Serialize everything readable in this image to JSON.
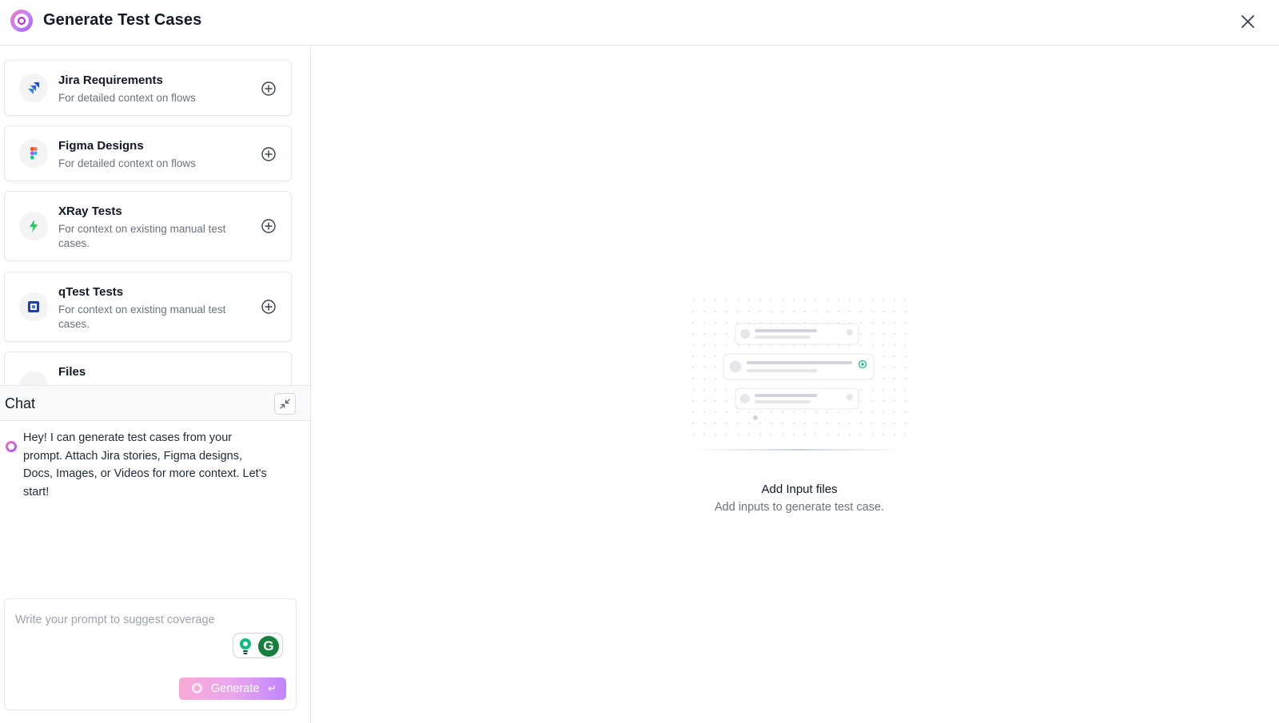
{
  "header": {
    "title": "Generate Test Cases",
    "logo_icon": "app-logo-icon",
    "close_icon": "close-icon"
  },
  "sources": [
    {
      "title": "Jira Requirements",
      "description": "For detailed context on flows",
      "icon": "jira-icon"
    },
    {
      "title": "Figma Designs",
      "description": "For detailed context on flows",
      "icon": "figma-icon"
    },
    {
      "title": "XRay Tests",
      "description": "For context on existing manual test cases.",
      "icon": "xray-icon"
    },
    {
      "title": "qTest Tests",
      "description": "For context on existing manual test cases.",
      "icon": "qtest-icon"
    },
    {
      "title": "Files",
      "description": "",
      "icon": "files-icon"
    }
  ],
  "chat": {
    "title": "Chat",
    "message": "Hey! I can generate test cases from your prompt. Attach Jira stories, Figma designs, Docs, Images, or Videos for more context. Let's start!",
    "input_placeholder": "Write your prompt to suggest coverage",
    "generate_label": "Generate",
    "generate_enter_glyph": "↵"
  },
  "empty_state": {
    "title": "Add Input files",
    "subtitle": "Add inputs to generate test case."
  },
  "colors": {
    "accent_pink": "#f9a8d4",
    "accent_purple": "#c084fc",
    "border": "#e5e7eb",
    "text_primary": "#111827",
    "text_secondary": "#6b7280"
  }
}
